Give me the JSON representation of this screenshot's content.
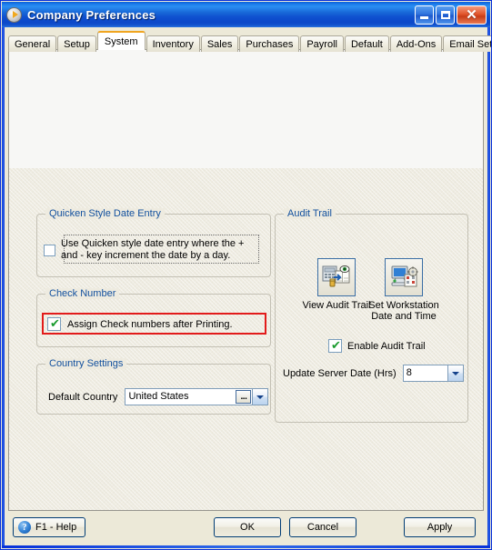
{
  "window": {
    "title": "Company Preferences",
    "icon": "app-circle-play-icon",
    "controls": {
      "minimize": "_",
      "maximize": "□",
      "close": "✕"
    }
  },
  "tabs": [
    {
      "label": "General",
      "selected": false
    },
    {
      "label": "Setup",
      "selected": false
    },
    {
      "label": "System",
      "selected": true
    },
    {
      "label": "Inventory",
      "selected": false
    },
    {
      "label": "Sales",
      "selected": false
    },
    {
      "label": "Purchases",
      "selected": false
    },
    {
      "label": "Payroll",
      "selected": false
    },
    {
      "label": "Default",
      "selected": false
    },
    {
      "label": "Add-Ons",
      "selected": false
    },
    {
      "label": "Email Setup",
      "selected": false
    }
  ],
  "groups": {
    "quicken": {
      "legend": "Quicken Style Date Entry",
      "checkbox": {
        "label": "Use Quicken style date entry where the + and - key increment the date by a day.",
        "checked": false
      }
    },
    "check_number": {
      "legend": "Check Number",
      "highlight_color": "#e21b1b",
      "checkbox": {
        "label": "Assign Check numbers after Printing.",
        "checked": true
      }
    },
    "country": {
      "legend": "Country Settings",
      "field_label": "Default Country",
      "value": "United States",
      "ellipsis_label": "...",
      "dropdown_icon": "chevron-down-icon"
    },
    "audit": {
      "legend": "Audit Trail",
      "buttons": [
        {
          "caption": "View Audit Trail",
          "icon": "view-audit-trail-icon"
        },
        {
          "caption": "Set Workstation Date and Time",
          "icon": "set-workstation-date-time-icon"
        }
      ],
      "enable_checkbox": {
        "label": "Enable Audit Trail",
        "checked": true
      },
      "update_label": "Update Server Date (Hrs)",
      "update_value": "8",
      "dropdown_icon": "chevron-down-icon"
    }
  },
  "footer": {
    "help": "F1 - Help",
    "help_icon": "question-mark-icon",
    "ok": "OK",
    "cancel": "Cancel",
    "apply": "Apply"
  },
  "colors": {
    "titlebar_blue": "#0831d9",
    "legend_blue": "#12509e",
    "highlight_red": "#e21b1b",
    "tab_accent": "#f0a520",
    "check_green": "#1a9b2e"
  }
}
